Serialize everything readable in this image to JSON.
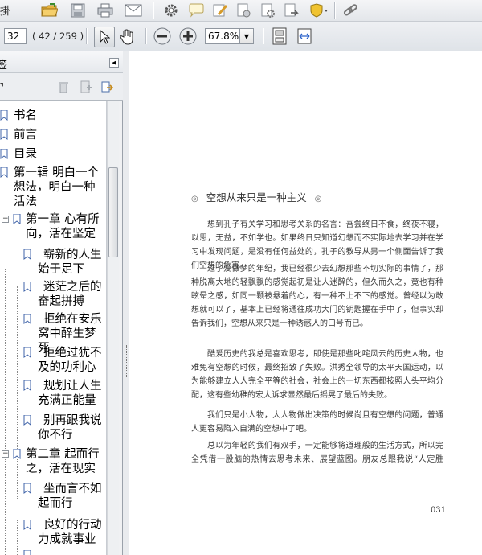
{
  "toolbar": {
    "fragment_left": "掛",
    "page_number": "32",
    "page_count": "( 42 / 259 )",
    "zoom": "67.8%"
  },
  "panel": {
    "title_fragment": "签"
  },
  "bookmarks": [
    "书名",
    "前言",
    "目录",
    "第一辑  明白一个想法，明白一种活法",
    "第一章  心有所向，活在坚定",
    "崭新的人生始于足下",
    "迷茫之后的奋起拼搏",
    "拒绝在安乐窝中醉生梦死",
    "拒绝过犹不及的功利心",
    "规划让人生充满正能量",
    "别再跟我说你不行",
    "第二章  起而行之，活在现实",
    "坐而言不如起而行",
    "良好的行动力成就事业"
  ],
  "document": {
    "title": "空想从来只是一种主义",
    "paragraphs": [
      "想到孔子有关学习和思考关系的名言：吾尝终日不食，终夜不寝，以思，无益，不如学也。如果终日只知道幻想而不实际地去学习并在学习中发现问题，是没有任何益处的，孔子的教导从另一个侧面告诉了我们空想的危害。",
      "过了爱做梦的年纪，我已经很少去幻想那些不切实际的事情了，那种脱离大地的轻飘飘的感觉起初是让人迷醉的，但久而久之，竟也有种眩晕之感，如同一颗被悬着的心，有一种不上不下的感觉。曾经以为敢想就可以了，基本上已经将通往成功大门的钥匙握在手中了，但事实却告诉我们，空想从来只是一种诱惑人的口号而已。",
      "酷爱历史的我总是喜欢思考，即使是那些叱咤风云的历史人物，也难免有空想的时候，最终招致了失败。洪秀全领导的太平天国运动，以为能够建立人人完全平等的社会，社会上的一切东西都按照人头平均分配，这有些幼稚的宏大诉求显然最后摇晃了最后的失败。",
      "我们只是小人物，大人物做出决策的时候尚且有空想的问题，普通人更容易陷入自满的空想中了吧。",
      "总以为年轻的我们有双手，一定能够将道理般的生活方式，所以完全凭借一股脑的热情去思考未来、展望蓝图。朋友总跟我说“人定胜天”，没有什"
    ],
    "page_label": "031"
  }
}
